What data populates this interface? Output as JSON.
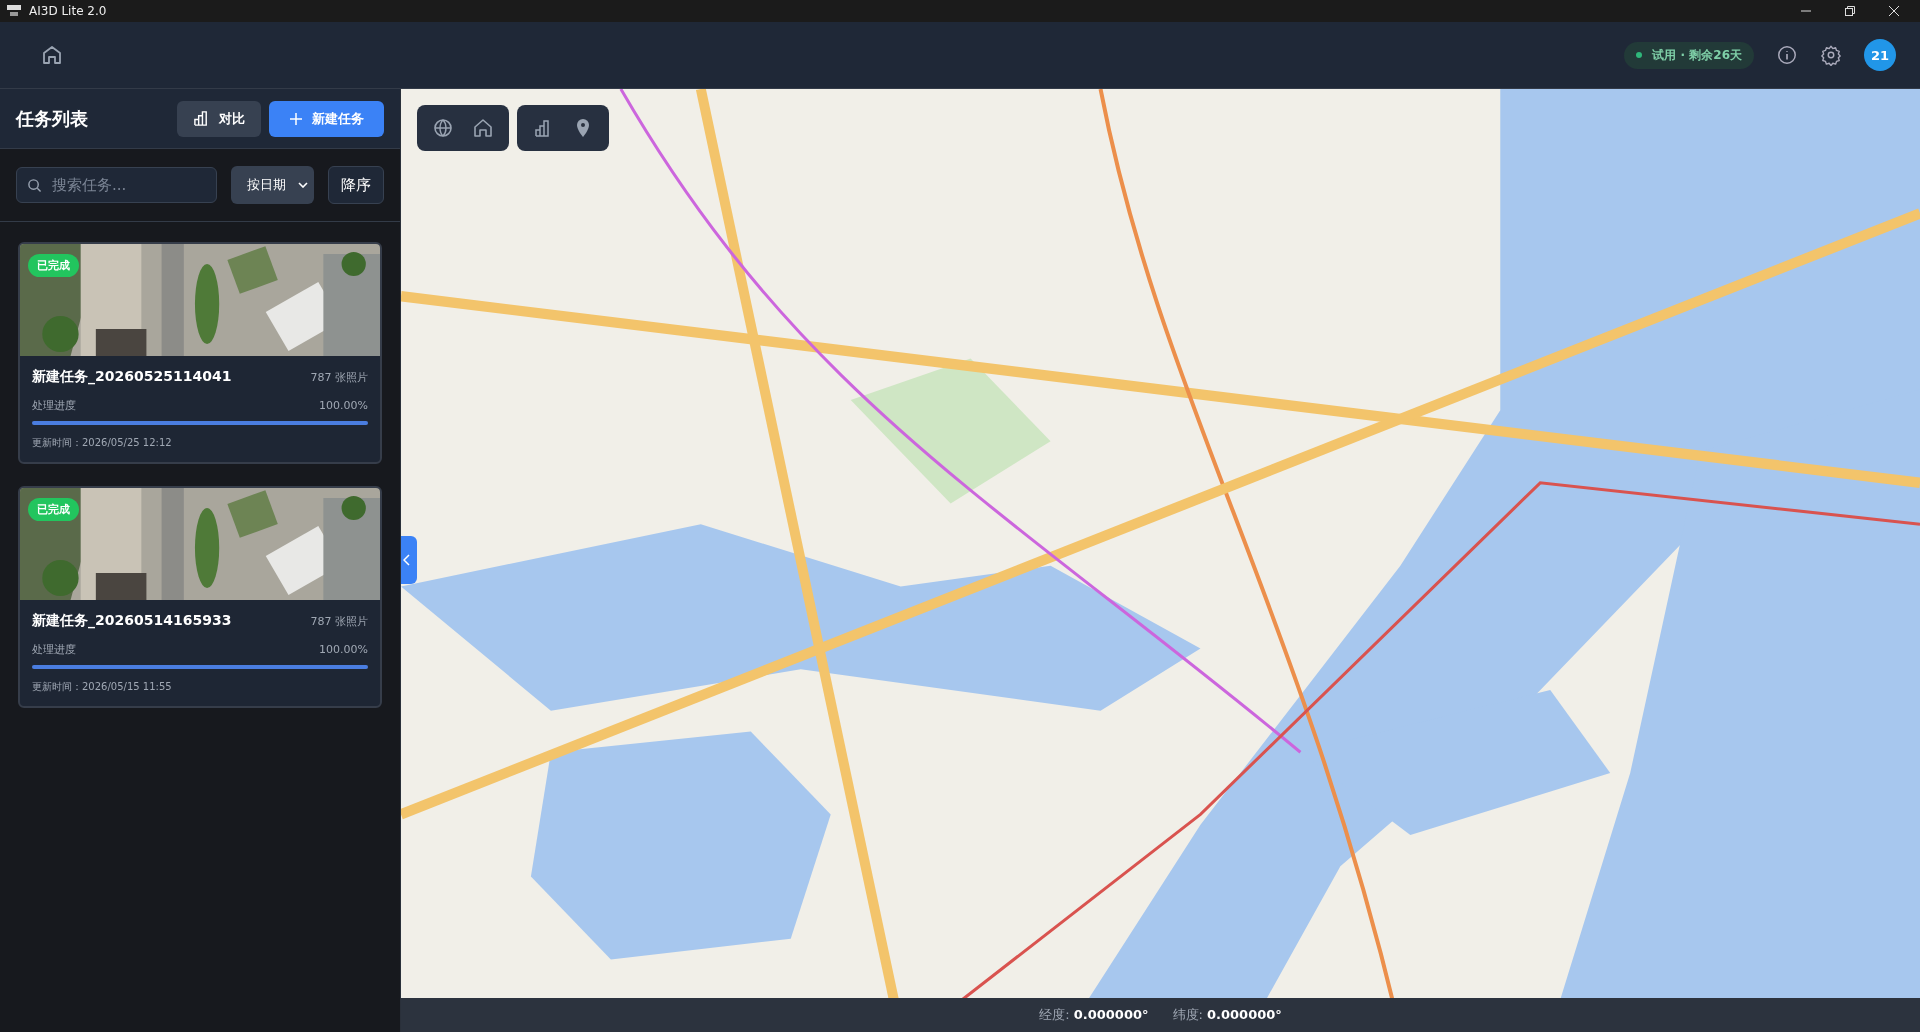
{
  "window": {
    "title": "AI3D Lite 2.0"
  },
  "header": {
    "trial_badge": "试用 · 剩余26天",
    "avatar": "21"
  },
  "sidebar": {
    "title": "任务列表",
    "compare_button": "对比",
    "new_task_button": "新建任务",
    "search": {
      "placeholder": "搜索任务..."
    },
    "sort_select": "按日期",
    "order_button": "降序",
    "tasks": [
      {
        "status": "已完成",
        "name": "新建任务_20260525114041",
        "photos": "787 张照片",
        "progress_label": "处理进度",
        "progress_text": "100.00%",
        "level": 1.0,
        "updated": "更新时间：2026/05/25 12:12"
      },
      {
        "status": "已完成",
        "name": "新建任务_20260514165933",
        "photos": "787 张照片",
        "progress_label": "处理进度",
        "progress_text": "100.00%",
        "level": 1.0,
        "updated": "更新时间：2026/05/15 11:55"
      }
    ]
  },
  "status_bar": {
    "longitude": "经度: **0.000000°**",
    "latitude": "纬度: **0.000000°**"
  }
}
